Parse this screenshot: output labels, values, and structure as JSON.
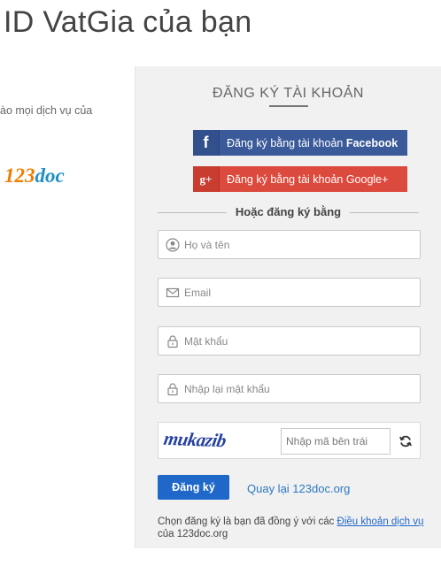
{
  "left": {
    "heading": "ID VatGia của bạn",
    "tagline": "ào mọi dịch vụ của",
    "logo": {
      "part1": "123",
      "part2": "doc"
    }
  },
  "panel": {
    "title": "ĐĂNG KÝ TÀI KHOẢN",
    "facebook": {
      "icon": "f",
      "prefix": "Đăng ký bằng tài khoản ",
      "brand": "Facebook"
    },
    "google": {
      "icon": "g+",
      "label": "Đăng ký bằng tài khoản Google+"
    },
    "divider": "Hoặc đăng ký bằng",
    "fields": {
      "name": "Họ và tên",
      "email": "Email",
      "password": "Mật khẩu",
      "confirm": "Nhập lại mật khẩu"
    },
    "captcha": {
      "text": "mukazib",
      "placeholder": "Nhập mã bên trái"
    },
    "submit": "Đăng ký",
    "back": "Quay lại 123doc.org",
    "terms": {
      "prefix": "Chọn đăng ký là bạn đã đồng ý với các ",
      "link": "Điều khoản dịch vụ",
      "suffix": " của 123doc.org"
    }
  },
  "icons": {
    "name_field": "user-icon",
    "email_field": "envelope-icon",
    "password_field": "lock-icon",
    "confirm_field": "lock-icon",
    "captcha_refresh": "refresh-icon"
  },
  "colors": {
    "facebook": "#3b5a9a",
    "google": "#dc4a3d",
    "primary": "#1f67c9",
    "link": "#2a78c2",
    "panel_bg": "#f1f1f1"
  }
}
